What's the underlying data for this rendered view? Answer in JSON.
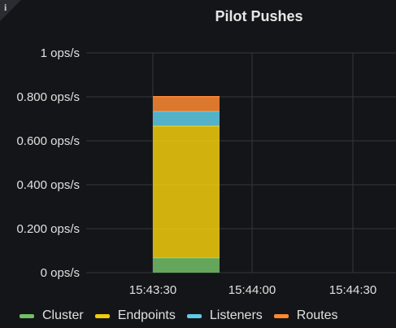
{
  "panel": {
    "info_glyph": "i",
    "title": "Pilot Pushes"
  },
  "chart_data": {
    "type": "bar",
    "stacked": true,
    "title": "Pilot Pushes",
    "xlabel": "",
    "ylabel": "",
    "ylim": [
      0,
      1
    ],
    "y_ticks": [
      {
        "value": 0,
        "label": "0 ops/s"
      },
      {
        "value": 0.2,
        "label": "0.200 ops/s"
      },
      {
        "value": 0.4,
        "label": "0.400 ops/s"
      },
      {
        "value": 0.6,
        "label": "0.600 ops/s"
      },
      {
        "value": 0.8,
        "label": "0.800 ops/s"
      },
      {
        "value": 1,
        "label": "1 ops/s"
      }
    ],
    "x_ticks": [
      "15:43:30",
      "15:44:00",
      "15:44:30"
    ],
    "categories": [
      "15:43:30"
    ],
    "series": [
      {
        "name": "Cluster",
        "color": "#73bf69",
        "values": [
          0.067
        ]
      },
      {
        "name": "Endpoints",
        "color": "#f2cc0c",
        "values": [
          0.6
        ]
      },
      {
        "name": "Listeners",
        "color": "#5ecce8",
        "values": [
          0.067
        ]
      },
      {
        "name": "Routes",
        "color": "#ff8833",
        "values": [
          0.067
        ]
      }
    ],
    "grid": true,
    "legend_position": "bottom-left"
  }
}
